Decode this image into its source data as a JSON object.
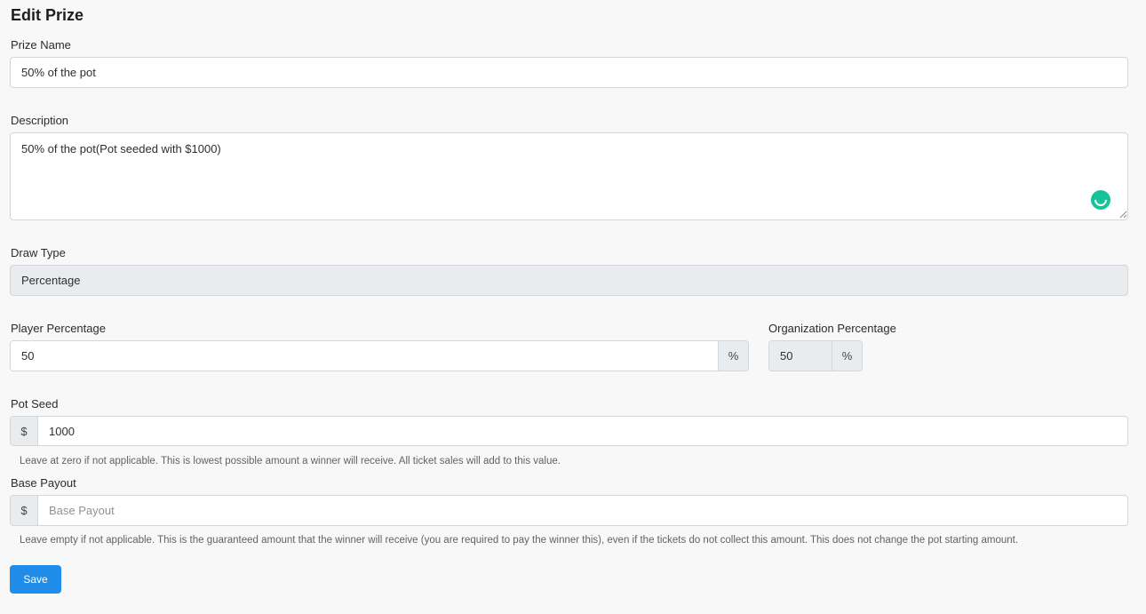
{
  "page_title": "Edit Prize",
  "prize_name": {
    "label": "Prize Name",
    "value": "50% of the pot"
  },
  "description": {
    "label": "Description",
    "value": "50% of the pot(Pot seeded with $1000)"
  },
  "draw_type": {
    "label": "Draw Type",
    "value": "Percentage"
  },
  "player_percentage": {
    "label": "Player Percentage",
    "value": "50",
    "suffix": "%"
  },
  "organization_percentage": {
    "label": "Organization Percentage",
    "value": "50",
    "suffix": "%"
  },
  "pot_seed": {
    "label": "Pot Seed",
    "prefix": "$",
    "value": "1000",
    "help": "Leave at zero if not applicable. This is lowest possible amount a winner will receive. All ticket sales will add to this value."
  },
  "base_payout": {
    "label": "Base Payout",
    "prefix": "$",
    "value": "",
    "placeholder": "Base Payout",
    "help": "Leave empty if not applicable. This is the guaranteed amount that the winner will receive (you are required to pay the winner this), even if the tickets do not collect this amount. This does not change the pot starting amount."
  },
  "save_label": "Save",
  "icons": {
    "grammarly": "grammarly-icon",
    "resize": "resize-handle-icon"
  },
  "colors": {
    "primary": "#1e8ce8",
    "grammarly": "#15c39a",
    "readonly_bg": "#e9ecef"
  }
}
